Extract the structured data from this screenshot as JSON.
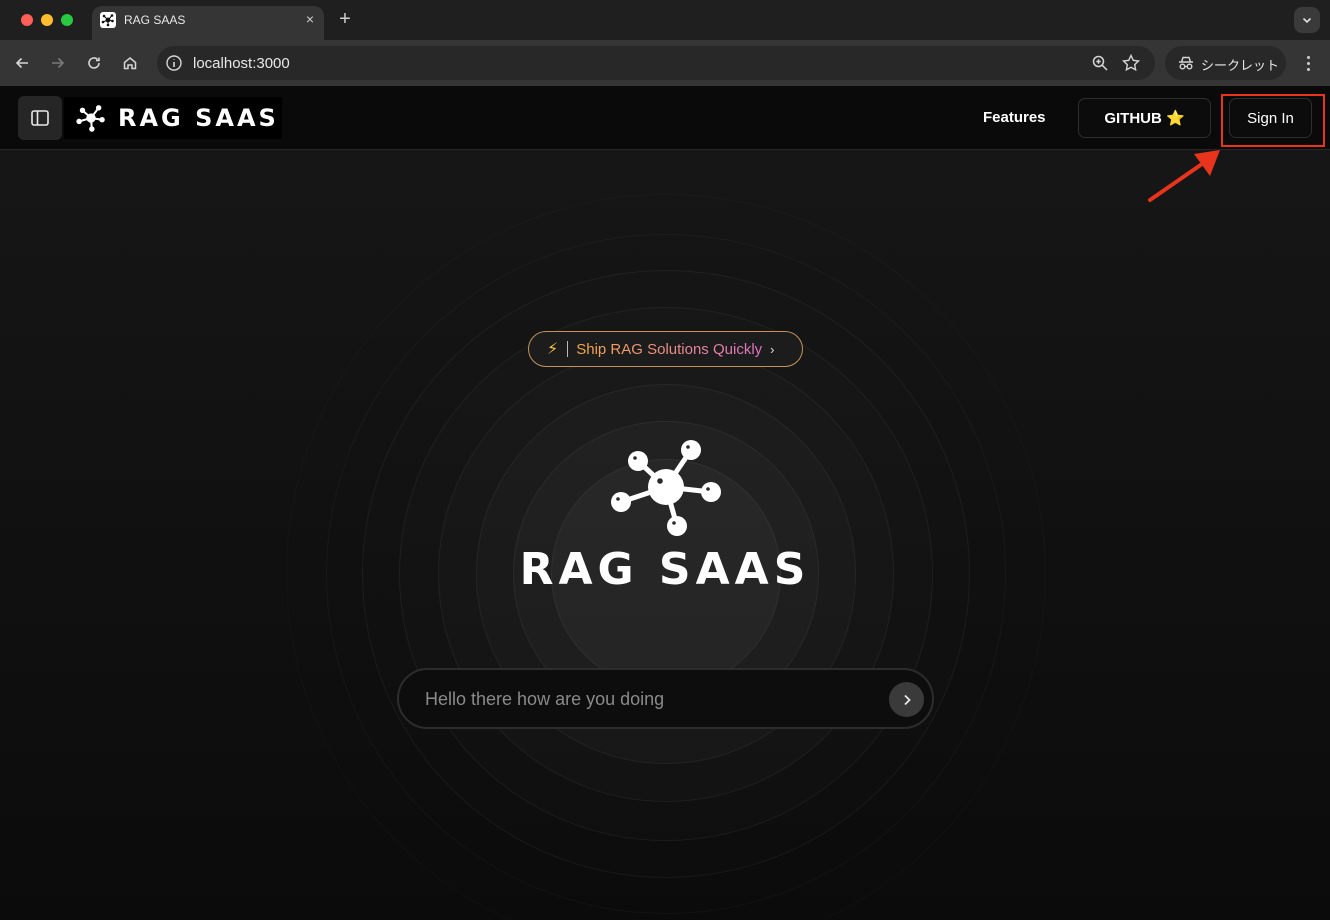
{
  "browser": {
    "tab_title": "RAG SAAS",
    "tab_close": "×",
    "new_tab": "+",
    "url": "localhost:3000",
    "incognito_label": "シークレット"
  },
  "header": {
    "brand": "RAG SAAS",
    "nav_features": "Features",
    "github_label": "GITHUB ⭐",
    "signin_label": "Sign In"
  },
  "hero": {
    "badge_icon": "⚡",
    "badge_text": "Ship RAG Solutions Quickly",
    "badge_chevron": "›",
    "title": "RAG SAAS"
  },
  "chat": {
    "placeholder": "Hello there how are you doing"
  },
  "colors": {
    "annotation_red": "#e8341c",
    "badge_gradient_start": "#f7a94a",
    "badge_gradient_end": "#e073c7"
  }
}
